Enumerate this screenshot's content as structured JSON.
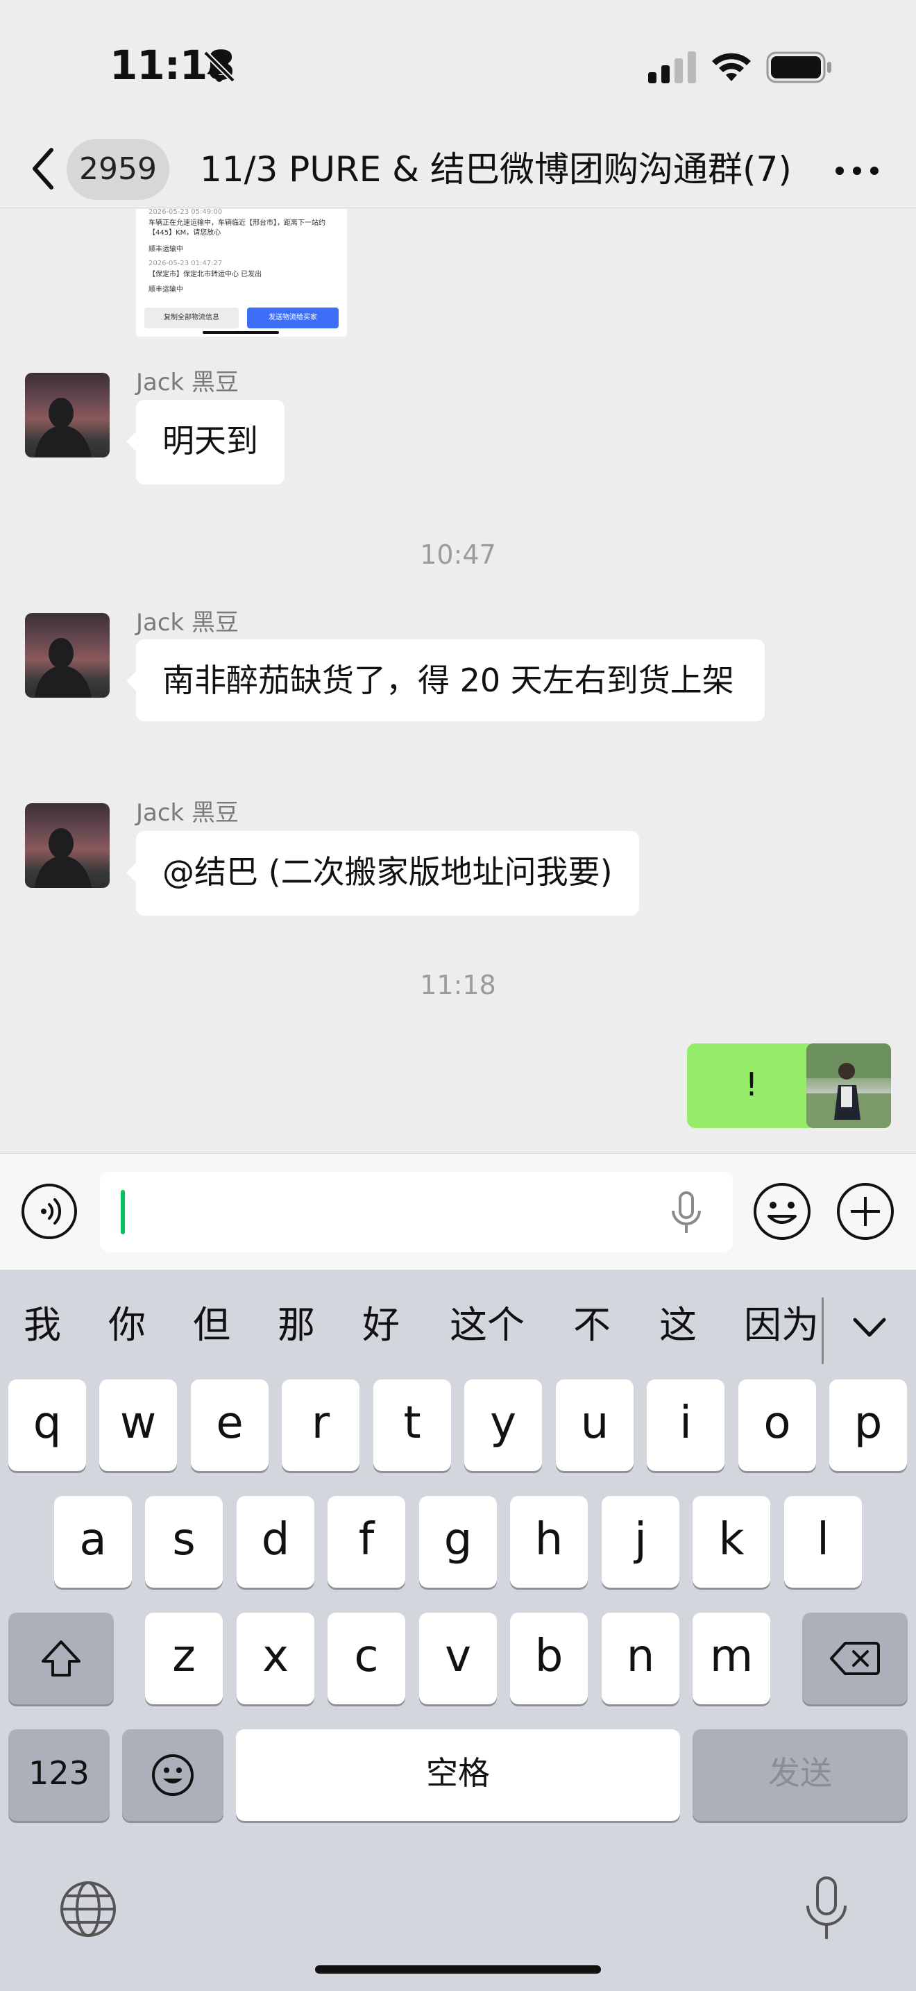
{
  "status_bar": {
    "time": "11:18"
  },
  "header": {
    "unread_count": "2959",
    "title": "11/3 PURE & 结巴微博团购沟通群(7)"
  },
  "chat": {
    "shared_screenshot": {
      "lines": [
        "2026-05-23 05:49:00",
        "车辆正在允速运输中，车辆临近【邢台市】，距离下一站约",
        "【445】KM，请您放心",
        "顺丰运输中",
        "2026-05-23 01:47:27",
        "【保定市】保定北市转运中心 已发出",
        "顺丰运输中"
      ],
      "copy_button": "复制全部物流信息",
      "send_button": "发送物流给买家"
    },
    "messages": [
      {
        "sender": "Jack 黑豆",
        "text": "明天到"
      },
      {
        "divider": "10:47"
      },
      {
        "sender": "Jack 黑豆",
        "text": "南非醉茄缺货了，得 20 天左右到货上架"
      },
      {
        "sender": "Jack 黑豆",
        "text": "@结巴 (二次搬家版地址问我要)"
      },
      {
        "divider": "11:18"
      },
      {
        "sender": "me",
        "text": "!"
      }
    ]
  },
  "input_bar": {
    "value": ""
  },
  "keyboard": {
    "suggestions": [
      "我",
      "你",
      "但",
      "那",
      "好",
      "这个",
      "不",
      "这",
      "因为"
    ],
    "row1": [
      "q",
      "w",
      "e",
      "r",
      "t",
      "y",
      "u",
      "i",
      "o",
      "p"
    ],
    "row2": [
      "a",
      "s",
      "d",
      "f",
      "g",
      "h",
      "j",
      "k",
      "l"
    ],
    "row3": [
      "z",
      "x",
      "c",
      "v",
      "b",
      "n",
      "m"
    ],
    "numbers_key": "123",
    "space_key": "空格",
    "send_key": "发送"
  },
  "icons": {
    "bell": "bell-slash-icon",
    "signal": "cellular-signal-icon",
    "wifi": "wifi-icon",
    "battery": "battery-icon",
    "back": "chevron-left-icon",
    "more": "more-dots-icon",
    "voice": "voice-input-icon",
    "mic": "microphone-icon",
    "emoji": "emoji-icon",
    "plus": "plus-icon",
    "shift": "shift-icon",
    "backspace": "backspace-icon",
    "globe": "globe-icon",
    "collapse": "chevron-down-icon"
  },
  "colors": {
    "self_bubble": "#95ec69",
    "cursor": "#07c160",
    "send_logistics_button": "#3d6ef7"
  }
}
